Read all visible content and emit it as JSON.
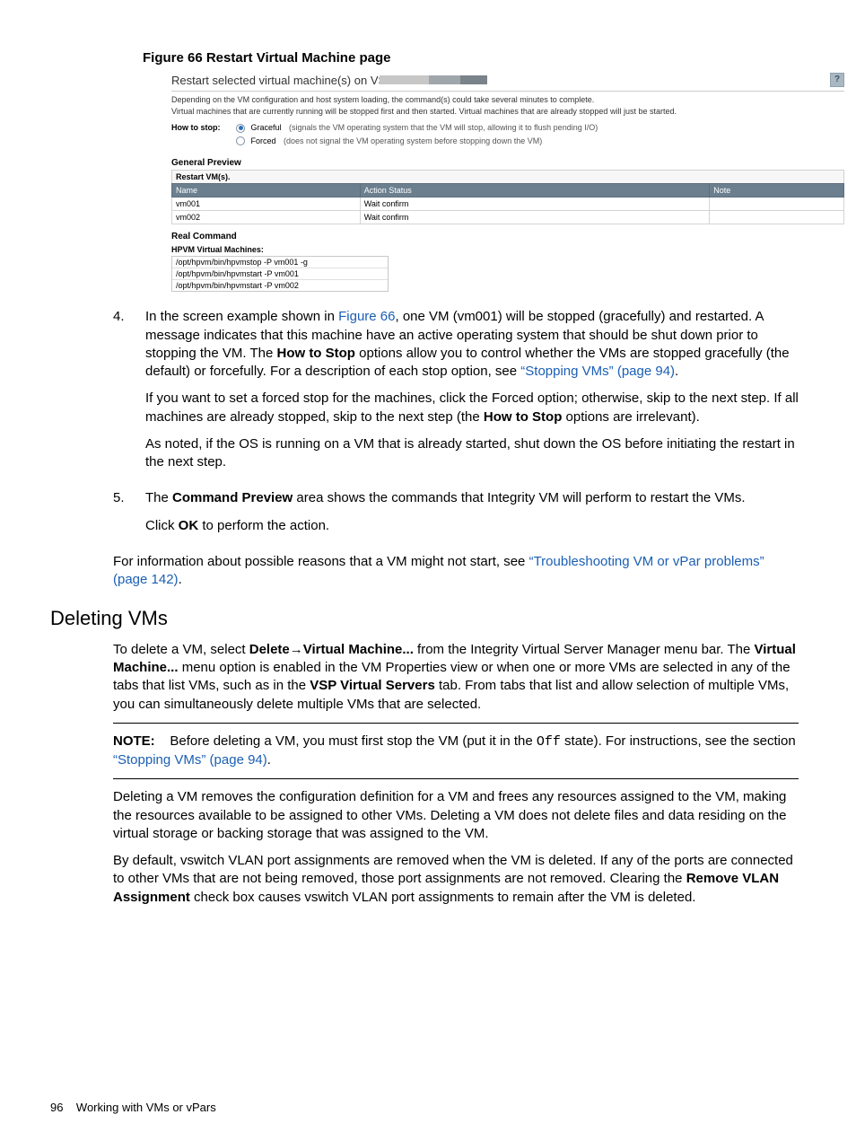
{
  "figure": {
    "caption": "Figure 66 Restart Virtual Machine page"
  },
  "screenshot": {
    "titlebar": "Restart selected virtual machine(s) on VSP",
    "help_glyph": "?",
    "desc1": "Depending on the VM configuration and host system loading, the command(s) could take several minutes to complete.",
    "desc2": "Virtual machines that are currently running will be stopped first and then started. Virtual machines that are already stopped will just be started.",
    "howto_label": "How to stop:",
    "opt_graceful": "Graceful",
    "opt_graceful_hint": "(signals the VM operating system that the VM will stop, allowing it to flush pending I/O)",
    "opt_forced": "Forced",
    "opt_forced_hint": "(does not signal the VM operating system before stopping down the VM)",
    "general_preview": "General Preview",
    "restart_vms": "Restart VM(s).",
    "th_name": "Name",
    "th_action": "Action Status",
    "th_note": "Note",
    "rows": [
      {
        "name": "vm001",
        "status": "Wait confirm",
        "note": ""
      },
      {
        "name": "vm002",
        "status": "Wait confirm",
        "note": ""
      }
    ],
    "real_command": "Real Command",
    "hpvm_label": "HPVM Virtual Machines:",
    "cmds": [
      "/opt/hpvm/bin/hpvmstop -P vm001 -g",
      "/opt/hpvm/bin/hpvmstart -P vm001",
      "/opt/hpvm/bin/hpvmstart -P vm002"
    ]
  },
  "step4": {
    "num": "4.",
    "p1a": "In the screen example shown in ",
    "p1link": "Figure 66",
    "p1b": ", one VM (vm001) will be stopped (gracefully) and restarted. A message indicates that this machine have an active operating system that should be shut down prior to stopping the VM. The ",
    "p1bold": "How to Stop",
    "p1c": " options allow you to control whether the VMs are stopped gracefully (the default) or forcefully. For a description of each stop option, see ",
    "p1link2": "“Stopping VMs” (page 94)",
    "p1d": ".",
    "p2a": "If you want to set a forced stop for the machines, click the Forced option; otherwise, skip to the next step. If all machines are already stopped, skip to the next step (the ",
    "p2bold": "How to Stop",
    "p2b": " options are irrelevant).",
    "p3": "As noted, if the OS is running on a VM that is already started, shut down the OS before initiating the restart in the next step."
  },
  "step5": {
    "num": "5.",
    "p1a": "The ",
    "p1bold": "Command Preview",
    "p1b": " area shows the commands that Integrity VM will perform to restart the VMs.",
    "p2a": "Click ",
    "p2bold": "OK",
    "p2b": " to perform the action."
  },
  "trouble": {
    "a": "For information about possible reasons that a VM might not start, see ",
    "link": "“Troubleshooting VM or vPar problems” (page 142)",
    "b": "."
  },
  "deleting": {
    "heading": "Deleting VMs",
    "p1a": "To delete a VM, select ",
    "p1b1": "Delete",
    "arrow": "→",
    "p1b2": "Virtual Machine...",
    "p1c": " from the Integrity Virtual Server Manager menu bar. The ",
    "p1b3": "Virtual Machine...",
    "p1d": " menu option is enabled in the VM Properties view or when one or more VMs are selected in any of the tabs that list VMs, such as in the ",
    "p1b4": "VSP Virtual Servers",
    "p1e": " tab. From tabs that list and allow selection of multiple VMs, you can simultaneously delete multiple VMs that are selected.",
    "note_label": "NOTE:",
    "note_a": "Before deleting a VM, you must first stop the VM (put it in the ",
    "note_code": "Off",
    "note_b": " state). For instructions, see the section ",
    "note_link": "“Stopping VMs” (page 94)",
    "note_c": ".",
    "p2": "Deleting a VM removes the configuration definition for a VM and frees any resources assigned to the VM, making the resources available to be assigned to other VMs. Deleting a VM does not delete files and data residing on the virtual storage or backing storage that was assigned to the VM.",
    "p3a": "By default, vswitch VLAN port assignments are removed when the VM is deleted. If any of the ports are connected to other VMs that are not being removed, those port assignments are not removed. Clearing the ",
    "p3bold": "Remove VLAN Assignment",
    "p3b": " check box causes vswitch VLAN port assignments to remain after the VM is deleted."
  },
  "footer": {
    "page": "96",
    "title": "Working with VMs or vPars"
  }
}
